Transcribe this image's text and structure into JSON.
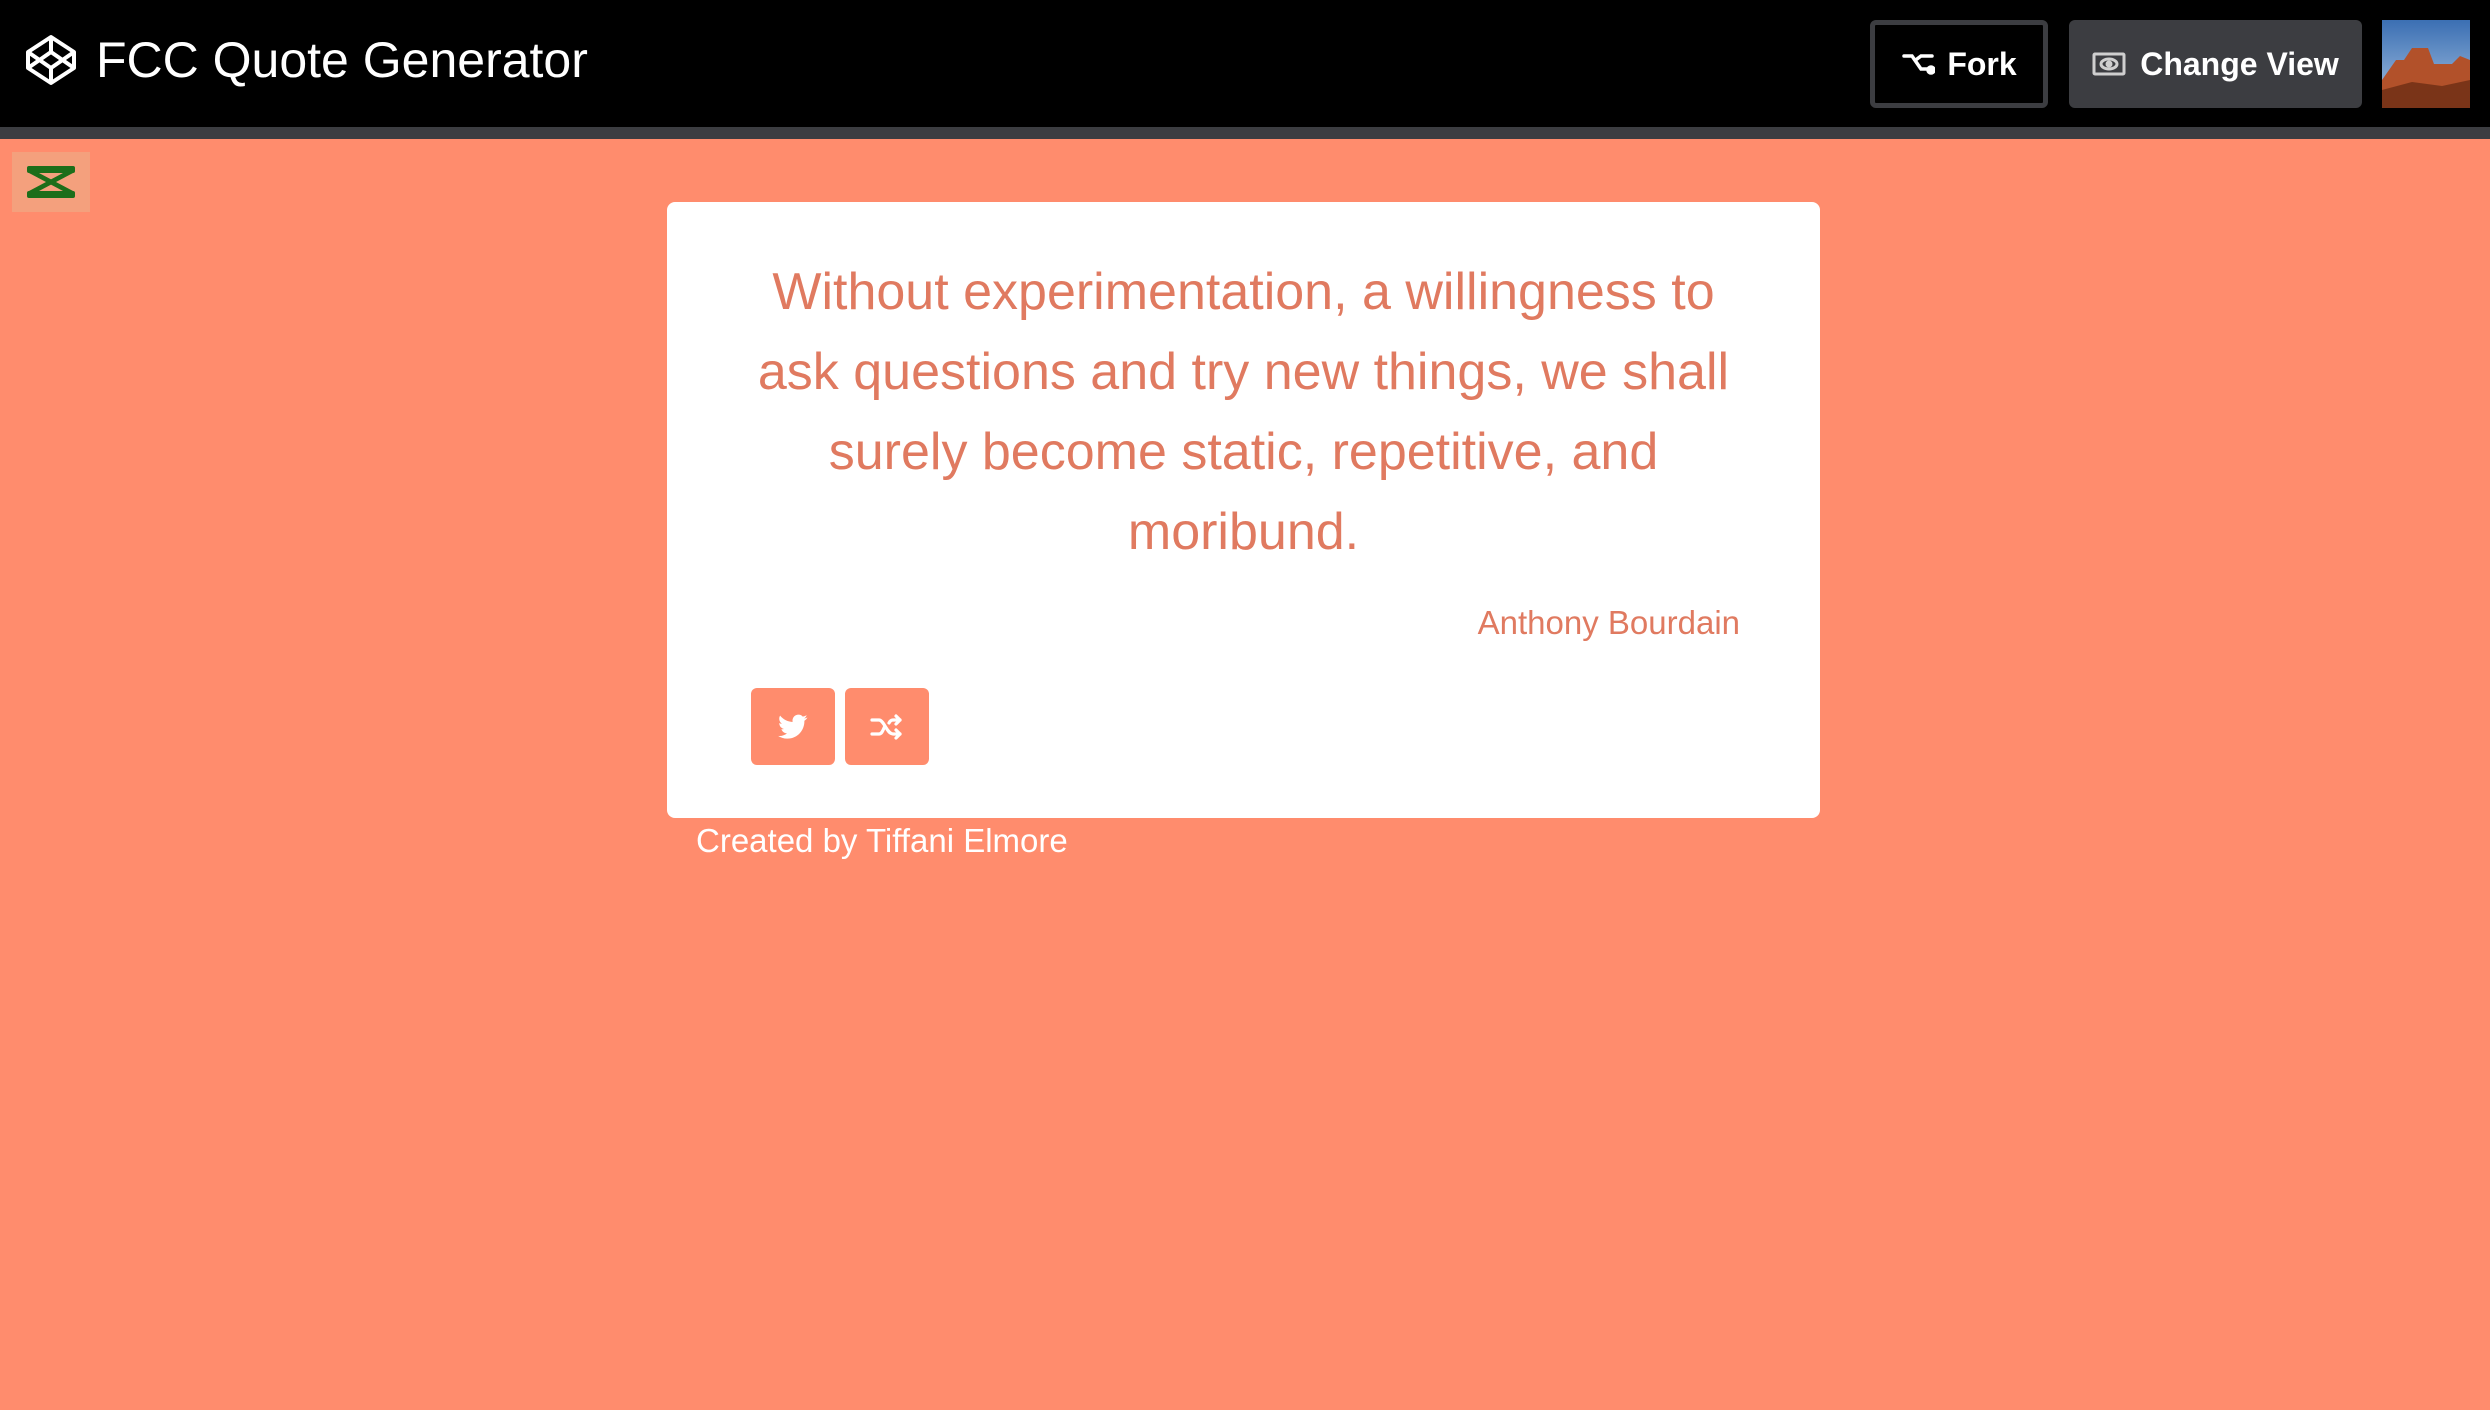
{
  "header": {
    "title": "FCC Quote Generator",
    "fork_label": "Fork",
    "change_view_label": "Change View",
    "logo_icon": "codepen-icon",
    "fork_icon": "fork-icon",
    "change_view_icon": "eye-icon",
    "avatar_alt": "desert landscape avatar"
  },
  "quote": {
    "text": "Without experimentation, a willingness to ask questions and try new things, we shall surely become static, repetitive, and moribund.",
    "author": "Anthony Bourdain"
  },
  "actions": {
    "tweet_icon": "twitter-icon",
    "new_quote_icon": "shuffle-icon"
  },
  "footer": {
    "credit": "Created by Tiffani Elmore"
  },
  "colors": {
    "background": "#ff8c6d",
    "accent_text": "#e07a60",
    "header_bg": "#000000",
    "button_dark": "#3c3d41",
    "card_bg": "#ffffff"
  }
}
